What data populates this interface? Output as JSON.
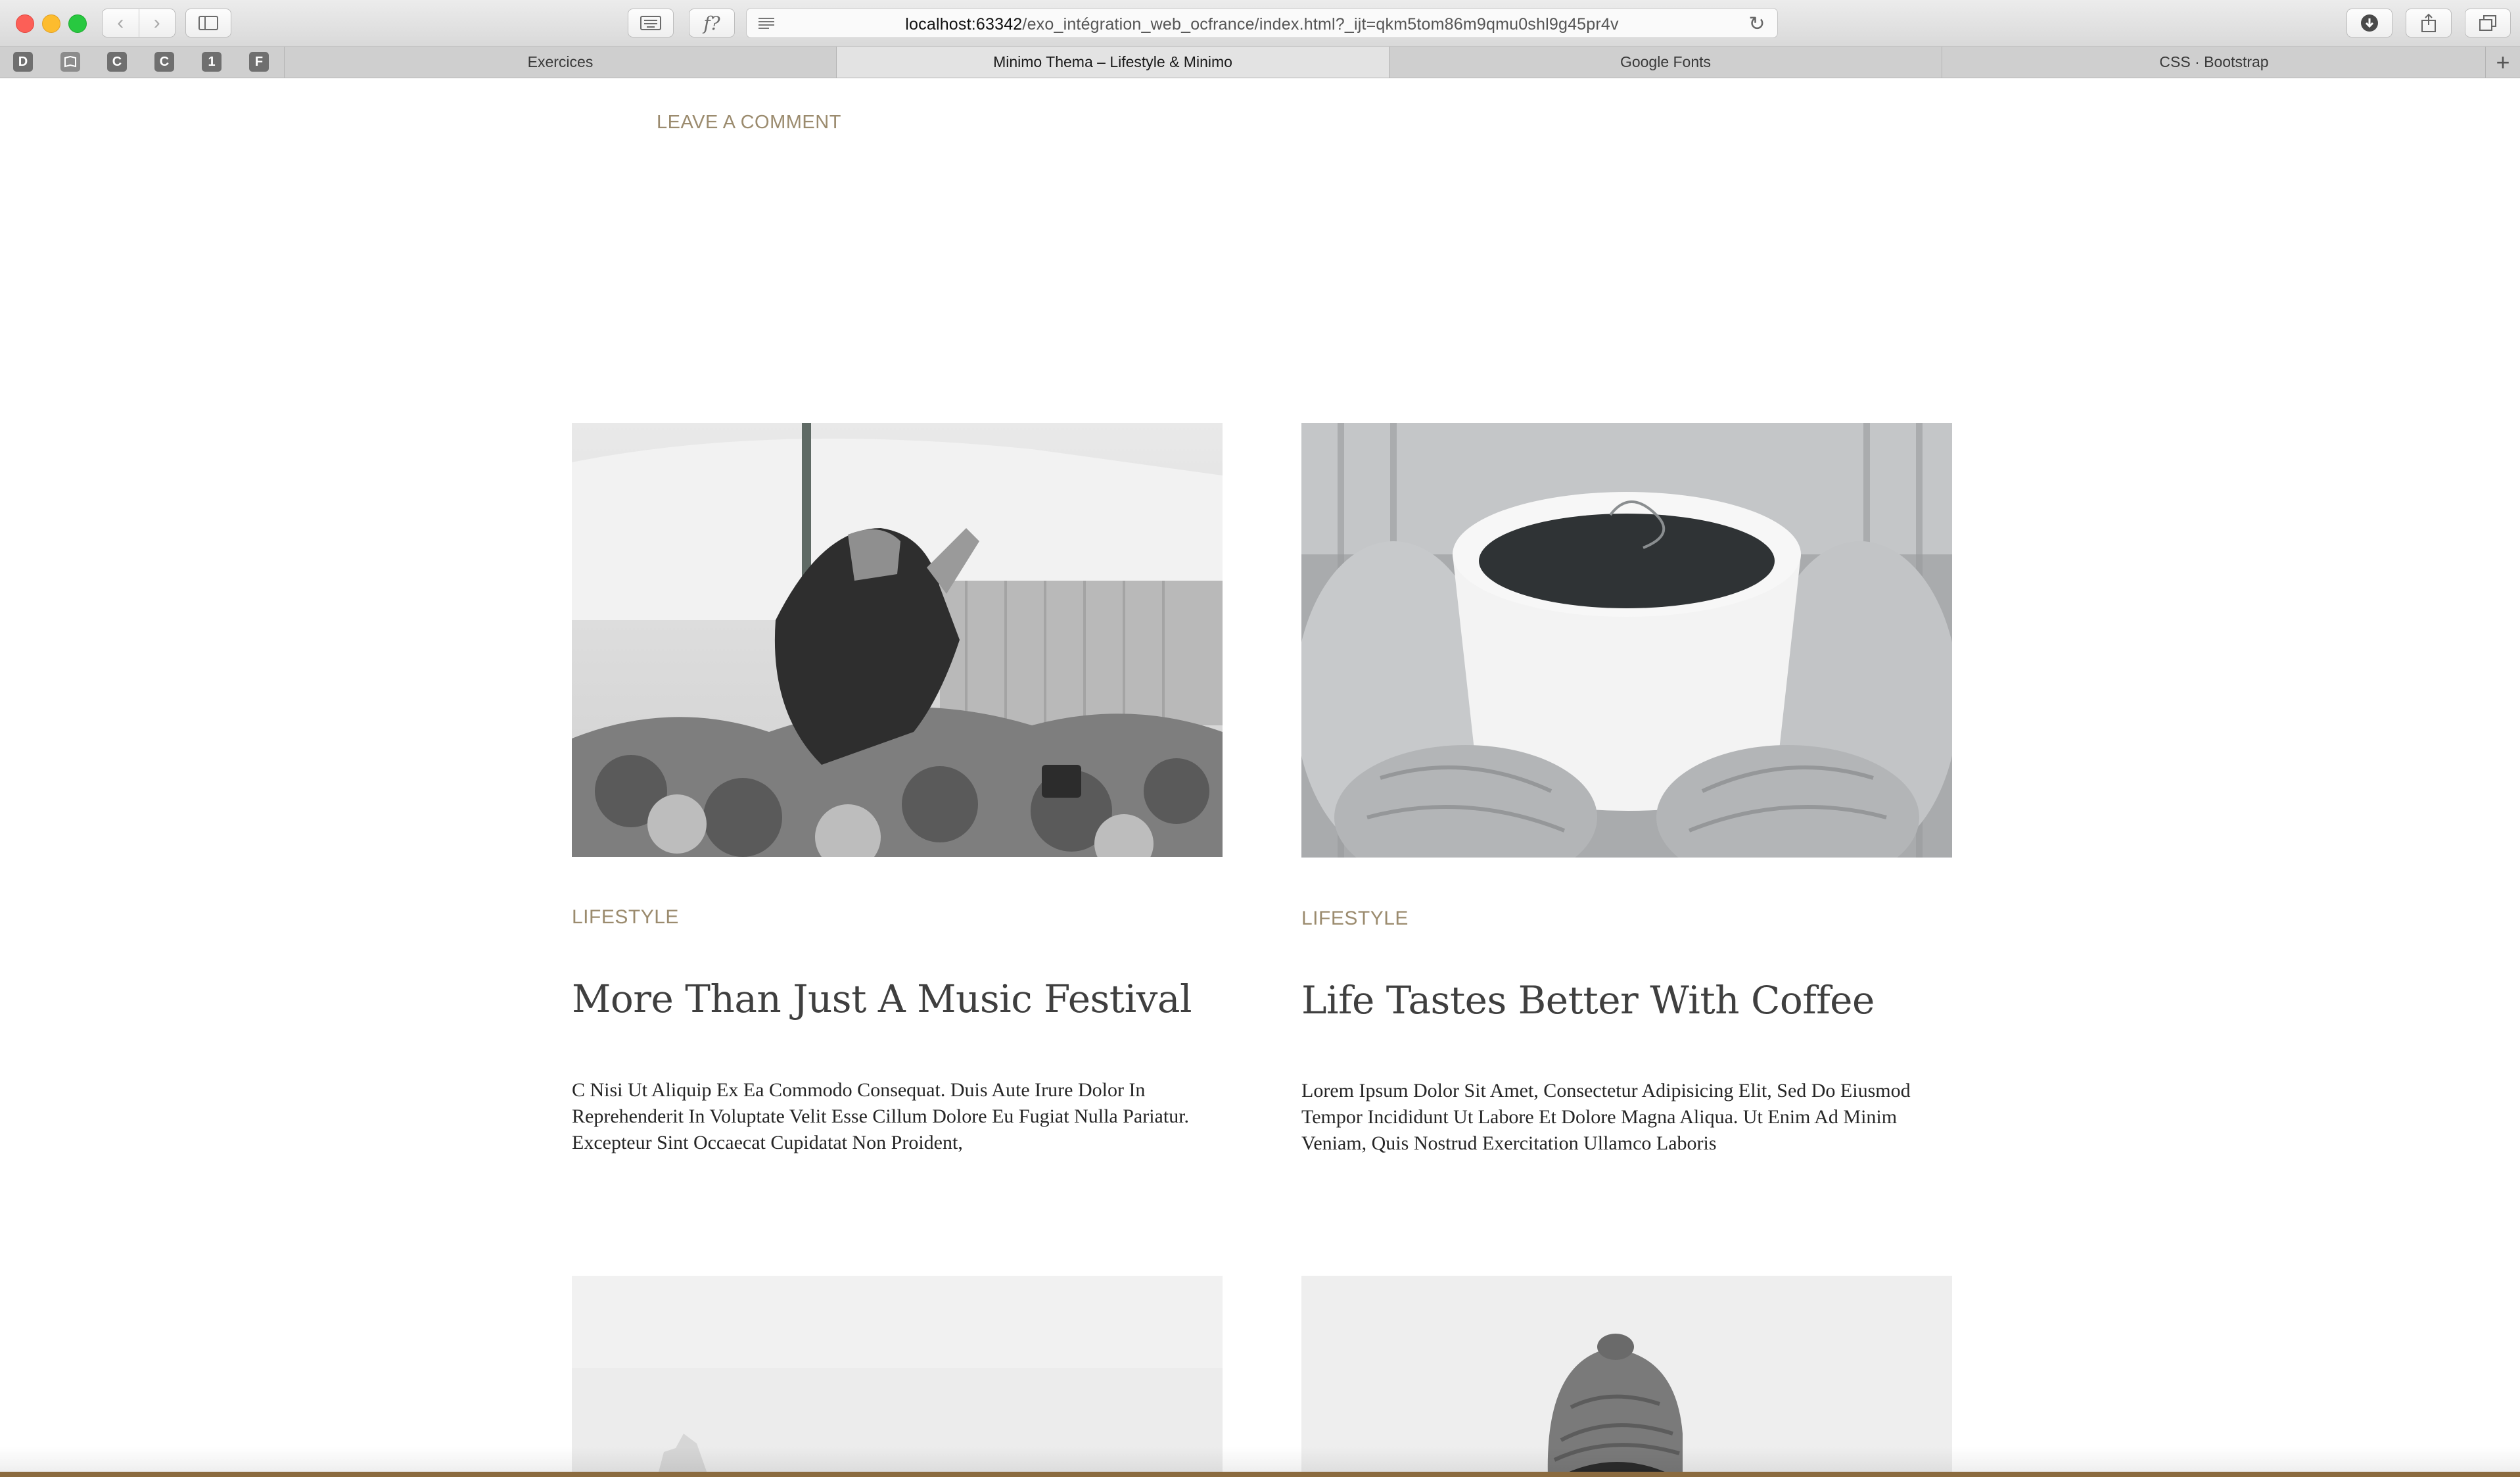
{
  "browser": {
    "url_host": "localhost:63342",
    "url_path": "/exo_intégration_web_ocfrance/index.html?_ijt=qkm5tom86m9qmu0shl9g45pr4v",
    "pinned_tabs": [
      "D",
      "",
      "C",
      "C",
      "1",
      "F"
    ],
    "tabs": [
      {
        "label": "Exercices",
        "active": false
      },
      {
        "label": "Minimo Thema – Lifestyle & Minimo",
        "active": true
      },
      {
        "label": "Google Fonts",
        "active": false
      },
      {
        "label": "CSS · Bootstrap",
        "active": false
      }
    ]
  },
  "page": {
    "leave_comment": "LEAVE A COMMENT",
    "posts": [
      {
        "category": "LIFESTYLE",
        "title": "More Than Just A Music Festival",
        "excerpt": "C Nisi Ut Aliquip Ex Ea Commodo Consequat. Duis Aute Irure Dolor In Reprehenderit In Voluptate Velit Esse Cillum Dolore Eu Fugiat Nulla Pariatur. Excepteur Sint Occaecat Cupidatat Non Proident,",
        "image": "festival-crowd-photo"
      },
      {
        "category": "LIFESTYLE",
        "title": "Life Tastes Better With Coffee",
        "excerpt": "Lorem Ipsum Dolor Sit Amet, Consectetur Adipisicing Elit, Sed Do Eiusmod Tempor Incididunt Ut Labore Et Dolore Magna Aliqua. Ut Enim Ad Minim Veniam, Quis Nostrud Exercitation Ullamco Laboris",
        "image": "coffee-mittens-photo"
      },
      {
        "image": "foggy-landscape-photo"
      },
      {
        "image": "beanie-person-photo"
      }
    ]
  },
  "colors": {
    "accent": "#9b8b6e",
    "title": "#3f3f3f",
    "text": "#262626"
  }
}
